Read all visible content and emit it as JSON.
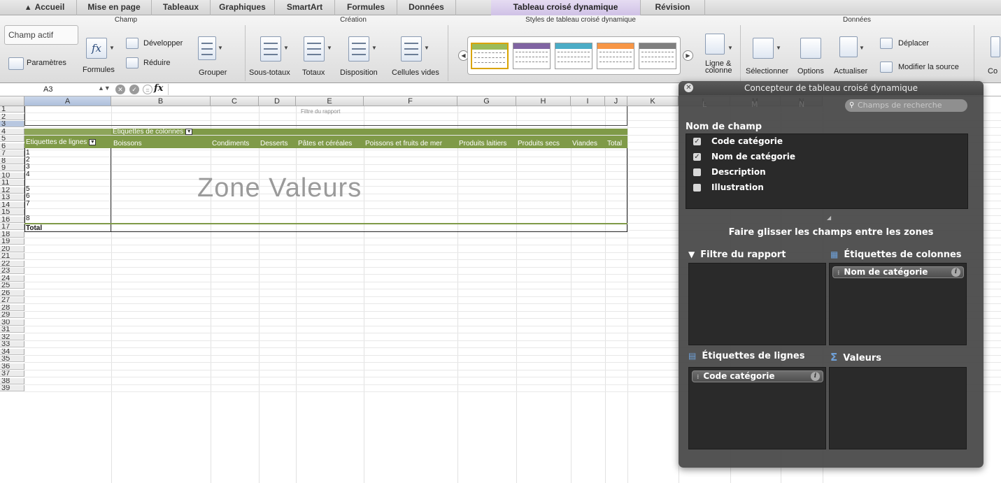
{
  "tabs": [
    {
      "label": "Accueil"
    },
    {
      "label": "Mise en page"
    },
    {
      "label": "Tableaux"
    },
    {
      "label": "Graphiques"
    },
    {
      "label": "SmartArt"
    },
    {
      "label": "Formules"
    },
    {
      "label": "Données"
    },
    {
      "label": "Tableau croisé dynamique"
    },
    {
      "label": "Révision"
    }
  ],
  "ribbon": {
    "group_champ": "Champ",
    "group_creation": "Création",
    "group_styles": "Styles de tableau croisé dynamique",
    "group_donnees": "Données",
    "champ_actif": "Champ actif",
    "parametres": "Paramètres",
    "formules": "Formules",
    "developper": "Développer",
    "reduire": "Réduire",
    "grouper": "Grouper",
    "sous_totaux": "Sous-totaux",
    "totaux": "Totaux",
    "disposition": "Disposition",
    "cellules_vides": "Cellules vides",
    "ligne_colonne_1": "Ligne &",
    "ligne_colonne_2": "colonne",
    "selectionner": "Sélectionner",
    "options": "Options",
    "actualiser": "Actualiser",
    "deplacer": "Déplacer",
    "modifier_source": "Modifier la source",
    "cut_label": "Co"
  },
  "formula_bar": {
    "name_box": "A3",
    "fx": "fx",
    "formula": ""
  },
  "grid": {
    "columns": [
      "A",
      "B",
      "C",
      "D",
      "E",
      "F",
      "G",
      "H",
      "I",
      "J",
      "K",
      "L",
      "M",
      "N"
    ],
    "rows": [
      "1",
      "2",
      "3",
      "4",
      "5",
      "6",
      "7",
      "8",
      "9",
      "10",
      "11",
      "12",
      "13",
      "14",
      "15",
      "16",
      "17",
      "18",
      "19",
      "20",
      "21",
      "22",
      "23",
      "24",
      "25",
      "26",
      "27",
      "28",
      "29",
      "30",
      "31",
      "32",
      "33",
      "34",
      "35",
      "36",
      "37",
      "38",
      "39"
    ]
  },
  "pivot": {
    "report_filter": "Filtre du rapport",
    "col_labels": "Etiquettes de colonnes",
    "row_labels": "Etiquettes de lignes",
    "headers": [
      "Boissons",
      "Condiments",
      "Desserts",
      "Pâtes et céréales",
      "Poissons et fruits de mer",
      "Produits laitiers",
      "Produits secs",
      "Viandes",
      "Total"
    ],
    "row_items": [
      "1",
      "2",
      "3",
      "4",
      "5",
      "6",
      "7",
      "8"
    ],
    "total": "Total",
    "zone_values": "Zone Valeurs"
  },
  "panel": {
    "title": "Concepteur de tableau croisé dynamique",
    "search_placeholder": "Champs de recherche",
    "field_name_header": "Nom de champ",
    "fields": [
      {
        "label": "Code catégorie",
        "checked": true
      },
      {
        "label": "Nom de catégorie",
        "checked": true
      },
      {
        "label": "Description",
        "checked": false
      },
      {
        "label": "Illustration",
        "checked": false
      }
    ],
    "drag_hint": "Faire glisser les champs entre les zones",
    "zone_report_filter": "Filtre du rapport",
    "zone_column_labels": "Étiquettes de colonnes",
    "zone_row_labels": "Étiquettes de lignes",
    "zone_values": "Valeurs",
    "column_field": "Nom de catégorie",
    "row_field": "Code catégorie"
  },
  "colors": {
    "pivot_header": "#7f9a48",
    "active_tab": "#d9cdec",
    "panel_bg": "#464646"
  }
}
